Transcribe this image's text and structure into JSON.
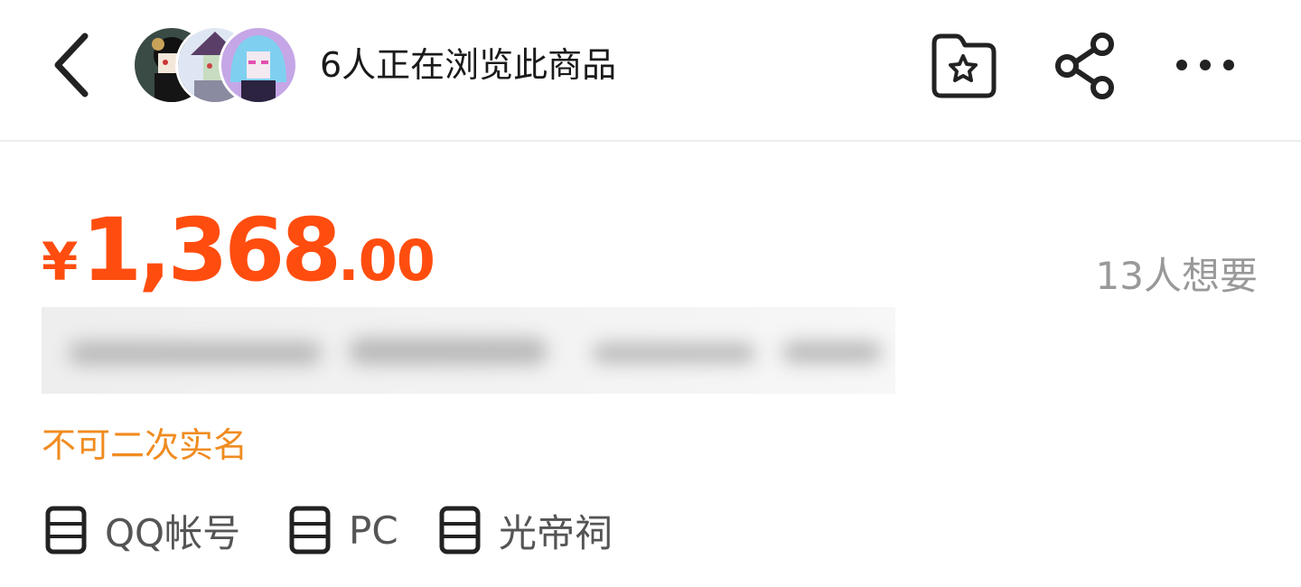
{
  "header": {
    "viewers_text": "6人正在浏览此商品",
    "icons": {
      "back": "chevron-left-icon",
      "favorite": "star-folder-icon",
      "share": "share-icon",
      "more": "more-horizontal-icon"
    }
  },
  "product": {
    "price_currency": "¥",
    "price_integer": "1,368",
    "price_decimal": ".00",
    "wants_text": "13人想要",
    "notice": "不可二次实名",
    "tags": [
      {
        "label": "QQ帐号",
        "icon": "list-icon"
      },
      {
        "label": "PC",
        "icon": "list-icon"
      },
      {
        "label": "光帝祠",
        "icon": "list-icon"
      }
    ]
  },
  "colors": {
    "price": "#ff4d0f",
    "notice": "#f08c21",
    "muted": "#999999"
  }
}
